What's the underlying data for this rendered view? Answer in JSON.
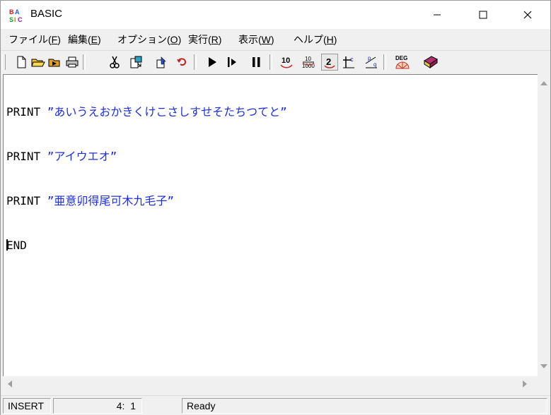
{
  "window": {
    "title": "BASIC",
    "controls": {
      "minimize": "—",
      "maximize": "☐",
      "close": "✕"
    }
  },
  "menu": [
    {
      "label": "ファイル",
      "key": "F"
    },
    {
      "label": "編集",
      "key": "E"
    },
    {
      "label": "オプション",
      "key": "O"
    },
    {
      "label": "実行",
      "key": "R"
    },
    {
      "label": "表示",
      "key": "W"
    },
    {
      "label": "ヘルプ",
      "key": "H"
    }
  ],
  "toolbar": {
    "buttons": [
      {
        "name": "new-file-icon"
      },
      {
        "name": "open-folder-icon"
      },
      {
        "name": "open-recent-icon"
      },
      {
        "name": "print-icon"
      },
      {
        "name": "cut-icon"
      },
      {
        "name": "paste-icon"
      },
      {
        "name": "insert-icon"
      },
      {
        "name": "undo-icon"
      },
      {
        "name": "run-icon"
      },
      {
        "name": "step-icon"
      },
      {
        "name": "pause-icon"
      },
      {
        "name": "base10-icon",
        "text": "10"
      },
      {
        "name": "decimal-precision-icon",
        "text": "10 1000"
      },
      {
        "name": "refresh-icon",
        "active": true
      },
      {
        "name": "tc-icon",
        "text": "c"
      },
      {
        "name": "pq-icon",
        "text": "p q"
      },
      {
        "name": "deg-icon",
        "text": "DEG"
      },
      {
        "name": "help-book-icon"
      }
    ]
  },
  "editor": {
    "lines": [
      {
        "keyword": "PRINT ",
        "string": "”あいうえおかきくけこさしすせそたちつてと”"
      },
      {
        "keyword": "PRINT ",
        "string": "”アイウエオ”"
      },
      {
        "keyword": "PRINT ",
        "string": "”亜意卯得尾可木九毛子”"
      },
      {
        "keyword": "END",
        "string": ""
      }
    ],
    "caret_line": 4
  },
  "status": {
    "mode": "INSERT",
    "position": "4:  1",
    "message": "Ready"
  },
  "colors": {
    "string": "#1c2ee0",
    "toolbar_bg": "#f0f0f0"
  }
}
